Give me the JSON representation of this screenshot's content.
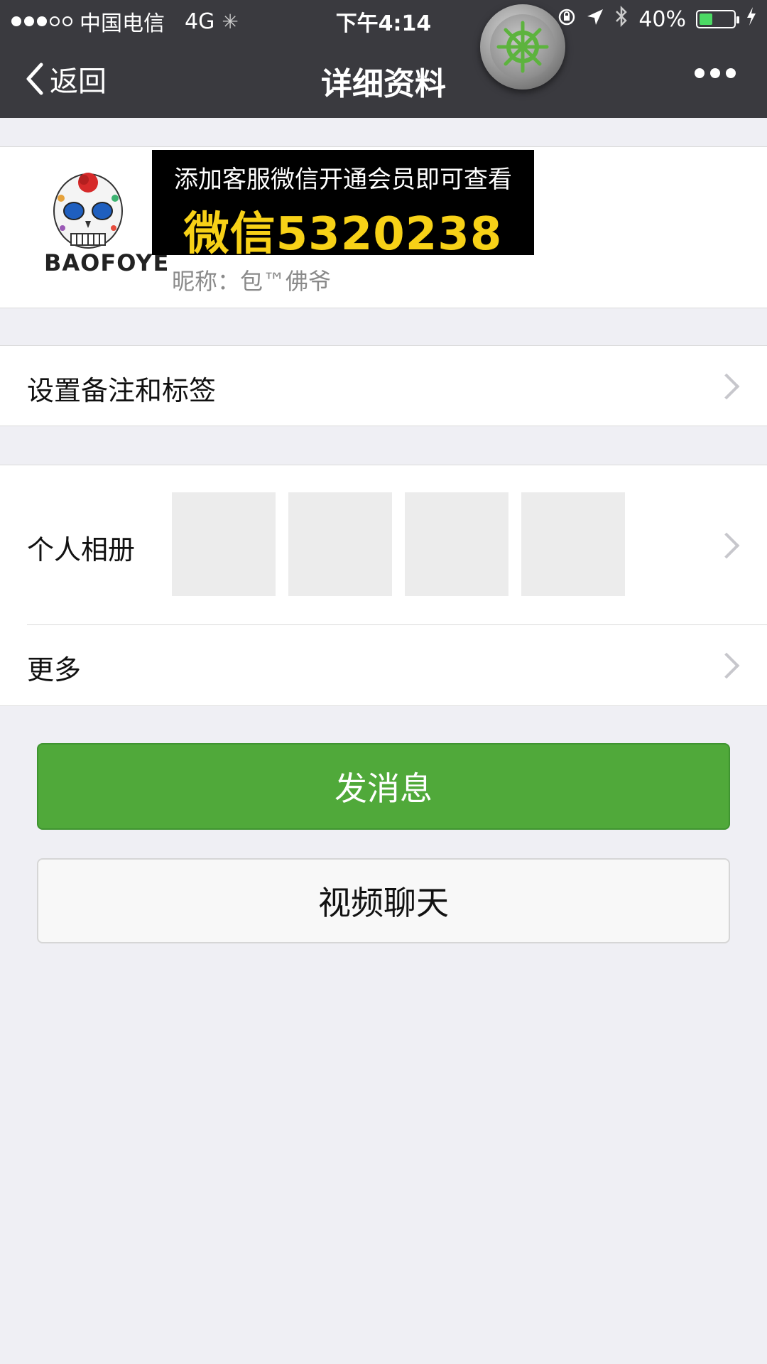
{
  "status": {
    "carrier": "中国电信",
    "network": "4G",
    "time": "下午4:14",
    "battery": "40%",
    "battery_level": 0.4,
    "signal_bars_filled": 3,
    "signal_bars_total": 5
  },
  "nav": {
    "back_label": "返回",
    "title": "详细资料"
  },
  "profile": {
    "avatar_brand": "BAOFOYE",
    "banner_line1": "添加客服微信开通会员即可查看",
    "banner_line2": "微信5320238",
    "nickname": "昵称：包™佛爷"
  },
  "rows": {
    "remark": "设置备注和标签",
    "album": "个人相册",
    "more": "更多"
  },
  "buttons": {
    "send": "发消息",
    "video": "视频聊天"
  },
  "colors": {
    "navbar": "#3a3a3f",
    "background": "#efeff4",
    "send_button": "#50a93a",
    "banner_highlight": "#f7d117"
  }
}
